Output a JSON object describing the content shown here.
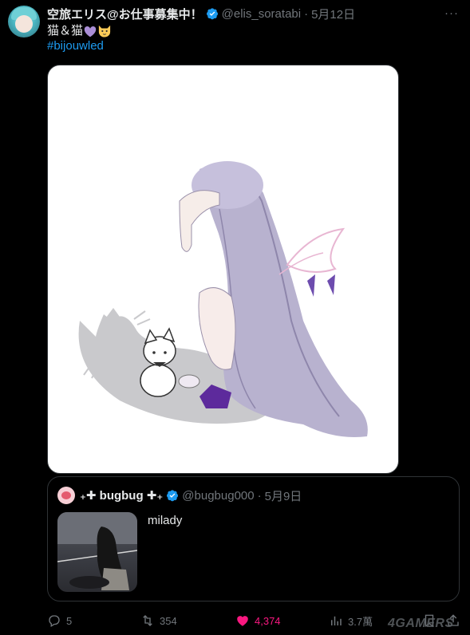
{
  "tweet": {
    "author_name": "空旅エリス@お仕事募集中！",
    "handle": "@elis_soratabi",
    "date": "5月12日",
    "text_start": "猫＆猫",
    "hashtag": "#bijouwled",
    "more_icon": "more-dots-icon",
    "verified_color": "#1d9bf0"
  },
  "quote": {
    "name": "bugbug",
    "name_prefix": "₊✚ ",
    "name_suffix": " ✚₊",
    "handle": "@bugbug000",
    "date": "5月9日",
    "text": "milady"
  },
  "actions": {
    "replies": "5",
    "retweets": "354",
    "likes": "4,374",
    "views": "3.7萬",
    "like_color": "#f91880"
  },
  "watermark": "4GAMERS"
}
